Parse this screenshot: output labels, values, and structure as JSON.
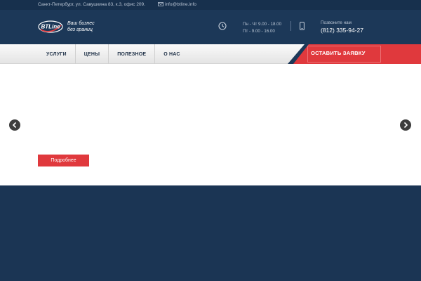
{
  "topbar": {
    "address": "Санкт-Петербург, ул. Савушкина 83, к.3, офис 209.",
    "email": "info@btline.info"
  },
  "header": {
    "logo_text": "BTLine",
    "slogan_line1": "Ваш бизнес",
    "slogan_line2": "без границ",
    "hours_line1": "Пн - Чт 9.00 - 18.00",
    "hours_line2": "Пт - 9.00 - 16.00",
    "call_label": "Позвоните нам",
    "phone": "(812) 335-94-27"
  },
  "nav": {
    "items": [
      {
        "label": "УСЛУГИ"
      },
      {
        "label": "ЦЕНЫ"
      },
      {
        "label": "ПОЛЕЗНОЕ"
      },
      {
        "label": "О НАС"
      }
    ],
    "cta_label": "ОСТАВИТЬ ЗАЯВКУ"
  },
  "slider": {
    "more_label": "Подробнее"
  },
  "colors": {
    "navy": "#1c3858",
    "accent_red": "#e0393d"
  }
}
